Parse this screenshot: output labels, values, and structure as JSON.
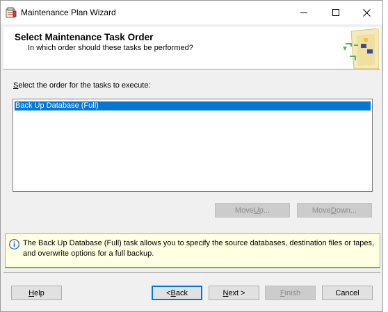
{
  "window": {
    "title": "Maintenance Plan Wizard"
  },
  "header": {
    "title": "Select Maintenance Task Order",
    "subtitle": "In which order should these tasks be performed?"
  },
  "main": {
    "order_label_accel": "S",
    "order_label_rest": "elect the order for the tasks to execute:",
    "tasks": [
      "Back Up Database (Full)"
    ],
    "selected_task_index": 0,
    "move_up_pre": "Move ",
    "move_up_accel": "U",
    "move_up_post": "p...",
    "move_down_pre": "Move ",
    "move_down_accel": "D",
    "move_down_post": "own..."
  },
  "info": {
    "text": "The Back Up Database (Full) task allows you to specify the source databases, destination files or tapes, and overwrite options for a full backup."
  },
  "footer": {
    "help_accel": "H",
    "help_rest": "elp",
    "back_pre": "< ",
    "back_accel": "B",
    "back_post": "ack",
    "next_accel": "N",
    "next_post": "ext >",
    "finish_accel": "F",
    "finish_post": "inish",
    "cancel_label": "Cancel"
  },
  "icons": {
    "app": "maintenance-plan-icon",
    "wizard": "wizard-graphic-icon",
    "info": "info-icon",
    "minimize": "minimize-icon",
    "maximize": "maximize-icon",
    "close": "close-icon"
  },
  "colors": {
    "selection": "#0078d7",
    "info_background": "#ffffe1",
    "dialog_background": "#f0f0f0"
  }
}
